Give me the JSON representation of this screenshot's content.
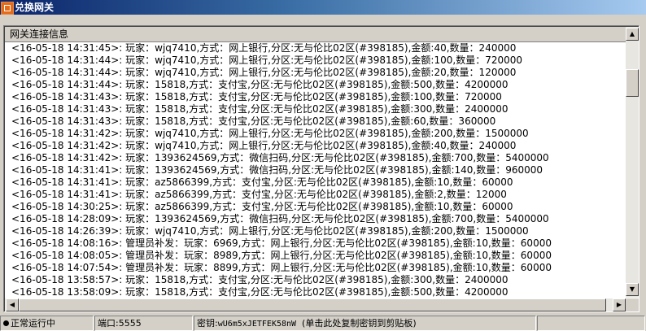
{
  "window": {
    "title": "兑换网关"
  },
  "panel": {
    "header": "网关连接信息"
  },
  "log": [
    "<16-05-18 14:31:45>: 玩家：wjq7410,方式：网上银行,分区:无与伦比02区(#398185),金额:40,数量：240000",
    "<16-05-18 14:31:44>: 玩家：wjq7410,方式：网上银行,分区:无与伦比02区(#398185),金额:100,数量：720000",
    "<16-05-18 14:31:44>: 玩家：wjq7410,方式：网上银行,分区:无与伦比02区(#398185),金额:20,数量：120000",
    "<16-05-18 14:31:44>: 玩家：15818,方式：支付宝,分区:无与伦比02区(#398185),金额:500,数量：4200000",
    "<16-05-18 14:31:43>: 玩家：15818,方式：支付宝,分区:无与伦比02区(#398185),金额:100,数量：720000",
    "<16-05-18 14:31:43>: 玩家：15818,方式：支付宝,分区:无与伦比02区(#398185),金额:300,数量：2400000",
    "<16-05-18 14:31:43>: 玩家：15818,方式：支付宝,分区:无与伦比02区(#398185),金额:60,数量：360000",
    "<16-05-18 14:31:42>: 玩家：wjq7410,方式：网上银行,分区:无与伦比02区(#398185),金额:200,数量：1500000",
    "<16-05-18 14:31:42>: 玩家：wjq7410,方式：网上银行,分区:无与伦比02区(#398185),金额:40,数量：240000",
    "<16-05-18 14:31:42>: 玩家：1393624569,方式：微信扫码,分区:无与伦比02区(#398185),金额:700,数量：5400000",
    "<16-05-18 14:31:41>: 玩家：1393624569,方式：微信扫码,分区:无与伦比02区(#398185),金额:140,数量：960000",
    "<16-05-18 14:31:41>: 玩家：az5866399,方式：支付宝,分区:无与伦比02区(#398185),金额:10,数量：60000",
    "<16-05-18 14:31:41>: 玩家：az5866399,方式：支付宝,分区:无与伦比02区(#398185),金额:2,数量：12000",
    "<16-05-18 14:30:25>: 玩家：az5866399,方式：支付宝,分区:无与伦比02区(#398185),金额:10,数量：60000",
    "<16-05-18 14:28:09>: 玩家：1393624569,方式：微信扫码,分区:无与伦比02区(#398185),金额:700,数量：5400000",
    "<16-05-18 14:26:39>: 玩家：wjq7410,方式：网上银行,分区:无与伦比02区(#398185),金额:200,数量：1500000",
    "<16-05-18 14:08:16>: 管理员补发：玩家：6969,方式：网上银行,分区:无与伦比02区(#398185),金额:10,数量：60000",
    "<16-05-18 14:08:05>: 管理员补发：玩家：8989,方式：网上银行,分区:无与伦比02区(#398185),金额:10,数量：60000",
    "<16-05-18 14:07:54>: 管理员补发：玩家：8899,方式：网上银行,分区:无与伦比02区(#398185),金额:10,数量：60000",
    "<16-05-18 13:58:57>: 玩家：15818,方式：支付宝,分区:无与伦比02区(#398185),金额:300,数量：2400000",
    "<16-05-18 13:58:09>: 玩家：15818,方式：支付宝,分区:无与伦比02区(#398185),金额:500,数量：4200000"
  ],
  "scroll": {
    "vertical_position": 0.1,
    "horizontal_position": 0.0
  },
  "status": {
    "state": "正常运行中",
    "port": "端口:5555",
    "key_label": "密钥:",
    "key_value": "wU6m5xJETFEK58nW",
    "key_hint": "(单击此处复制密钥到剪贴板)"
  },
  "icons": {
    "app": "app-icon",
    "up": "scroll-up-arrow-icon",
    "down": "scroll-down-arrow-icon",
    "left": "scroll-left-arrow-icon",
    "right": "scroll-right-arrow-icon",
    "status": "status-dot-icon"
  }
}
